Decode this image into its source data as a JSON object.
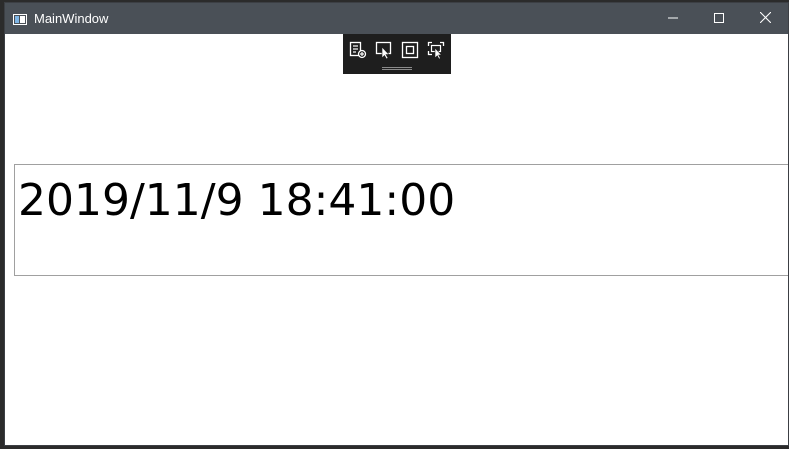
{
  "window": {
    "title": "MainWindow",
    "controls": {
      "minimize_icon": "minimize-icon",
      "maximize_icon": "maximize-icon",
      "close_icon": "close-icon"
    }
  },
  "debug_toolbar": {
    "buttons": [
      {
        "icon": "live-visual-tree-icon"
      },
      {
        "icon": "select-element-icon"
      },
      {
        "icon": "display-layout-adorners-icon"
      },
      {
        "icon": "track-focused-element-icon"
      }
    ]
  },
  "main": {
    "datetime_text": "2019/11/9 18:41:00"
  },
  "colors": {
    "titlebar": "#4a5057",
    "toolbar": "#1e1e1e",
    "textbox_border": "#a0a0a0",
    "window_bg": "#ffffff"
  }
}
